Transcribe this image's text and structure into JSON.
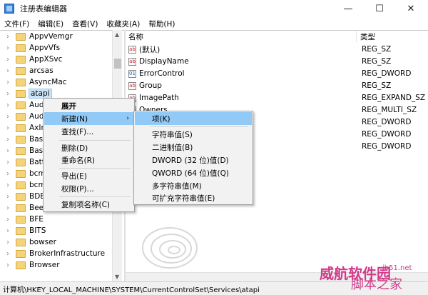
{
  "window": {
    "title": "注册表编辑器",
    "minimize": "—",
    "maximize": "☐",
    "close": "✕"
  },
  "menu": [
    "文件(F)",
    "编辑(E)",
    "查看(V)",
    "收藏夹(A)",
    "帮助(H)"
  ],
  "tree": {
    "items": [
      {
        "label": "AppvVemgr"
      },
      {
        "label": "AppvVfs"
      },
      {
        "label": "AppXSvc"
      },
      {
        "label": "arcsas"
      },
      {
        "label": "AsyncMac"
      },
      {
        "label": "atapi",
        "selected": true
      },
      {
        "label": "Audi"
      },
      {
        "label": "Audi"
      },
      {
        "label": "AxIn"
      },
      {
        "label": "Basic"
      },
      {
        "label": "Basic"
      },
      {
        "label": "BattC"
      },
      {
        "label": "bcm"
      },
      {
        "label": "bcm"
      },
      {
        "label": "BDES"
      },
      {
        "label": "Beep"
      },
      {
        "label": "BFE"
      },
      {
        "label": "BITS"
      },
      {
        "label": "bowser"
      },
      {
        "label": "BrokerInfrastructure"
      },
      {
        "label": "Browser"
      }
    ]
  },
  "list": {
    "header_name": "名称",
    "header_type": "类型",
    "rows": [
      {
        "name": "(默认)",
        "type": "REG_SZ",
        "kind": "string"
      },
      {
        "name": "DisplayName",
        "type": "REG_SZ",
        "kind": "string"
      },
      {
        "name": "ErrorControl",
        "type": "REG_DWORD",
        "kind": "binary"
      },
      {
        "name": "Group",
        "type": "REG_SZ",
        "kind": "string"
      },
      {
        "name": "ImagePath",
        "type": "REG_EXPAND_SZ",
        "kind": "string"
      },
      {
        "name": "Owners",
        "type": "REG_MULTI_SZ",
        "kind": "string"
      },
      {
        "name": "",
        "type": "REG_DWORD",
        "kind": "none"
      },
      {
        "name": "",
        "type": "REG_DWORD",
        "kind": "none"
      },
      {
        "name": "",
        "type": "REG_DWORD",
        "kind": "none"
      }
    ]
  },
  "context_menu": {
    "items": [
      "展开",
      "新建(N)",
      "查找(F)...",
      "删除(D)",
      "重命名(R)",
      "导出(E)",
      "权限(P)...",
      "复制项名称(C)"
    ],
    "submenu_arrow": "›"
  },
  "submenu": {
    "items": [
      "项(K)",
      "字符串值(S)",
      "二进制值(B)",
      "DWORD (32 位)值(D)",
      "QWORD (64 位)值(Q)",
      "多字符串值(M)",
      "可扩充字符串值(E)"
    ]
  },
  "status": {
    "path": "计算机\\HKEY_LOCAL_MACHINE\\SYSTEM\\CurrentControlSet\\Services\\atapi"
  },
  "watermark": {
    "line1": "威航软件园",
    "line2": "脚本之家",
    "line3": "jb51.net"
  }
}
